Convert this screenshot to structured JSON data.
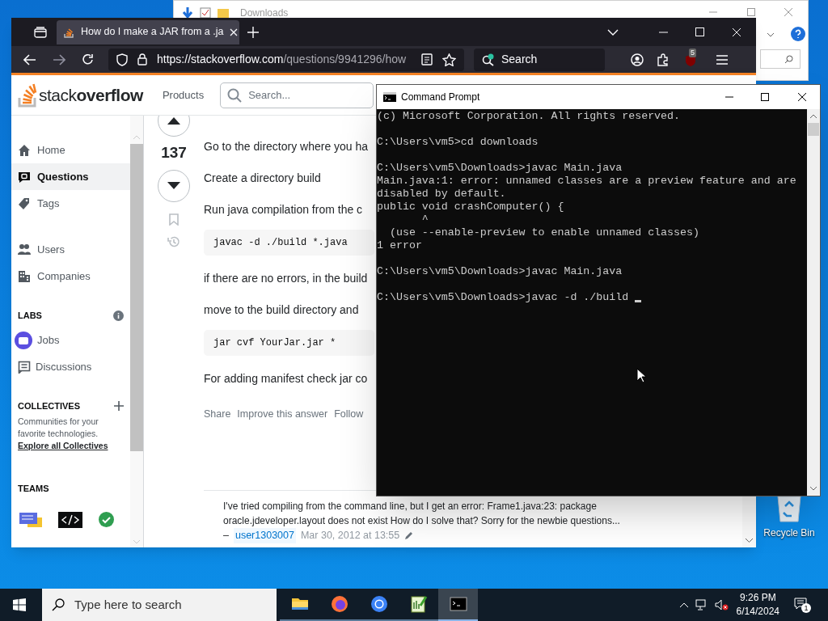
{
  "explorer": {
    "title": "Downloads"
  },
  "browser": {
    "tab_title": "How do I make a JAR from a .ja",
    "url_host": "https://stackoverflow.com",
    "url_path": "/questions/9941296/how",
    "search_placeholder": "Search",
    "extension_badge": "5"
  },
  "site": {
    "logo_light": "stack",
    "logo_bold": "overflow",
    "products": "Products",
    "search_placeholder": "Search...",
    "nav": [
      {
        "label": "Home",
        "selected": false
      },
      {
        "label": "Questions",
        "selected": true
      },
      {
        "label": "Tags",
        "selected": false
      },
      {
        "label": "Users",
        "selected": false
      },
      {
        "label": "Companies",
        "selected": false
      }
    ],
    "labs_heading": "LABS",
    "labs": [
      {
        "label": "Jobs"
      },
      {
        "label": "Discussions"
      }
    ],
    "collectives_heading": "COLLECTIVES",
    "collectives_text": "Communities for your favorite technologies.",
    "collectives_link": "Explore all Collectives",
    "teams_heading": "TEAMS"
  },
  "answer": {
    "score": "137",
    "paragraphs": [
      {
        "kind": "text",
        "text": "Go to the directory where you ha"
      },
      {
        "kind": "text",
        "text": "Create a directory build"
      },
      {
        "kind": "text",
        "text": "Run java compilation from the c"
      },
      {
        "kind": "code",
        "text": "javac -d ./build *.java"
      },
      {
        "kind": "text",
        "text": "if there are no errors, in the build"
      },
      {
        "kind": "text",
        "text": "move to the build directory and"
      },
      {
        "kind": "code",
        "text": "jar cvf YourJar.jar *"
      },
      {
        "kind": "text",
        "text": "For adding manifest check jar co"
      }
    ],
    "actions": [
      "Share",
      "Improve this answer",
      "Follow"
    ]
  },
  "comment": {
    "text": "I've tried compiling from the command line, but I get an error: Frame1.java:23: package oracle.jdeveloper.layout does not exist How do I solve that? Sorry for the newbie questions...",
    "dash": "–",
    "user": "user1303007",
    "date": "Mar 30, 2012 at 13:55"
  },
  "cmd": {
    "title": "Command Prompt",
    "blocks": [
      [
        "(c) Microsoft Corporation. All rights reserved."
      ],
      [
        "C:\\Users\\vm5>cd downloads"
      ],
      [
        "C:\\Users\\vm5\\Downloads>javac Main.java",
        "Main.java:1: error: unnamed classes are a preview feature and are",
        "disabled by default.",
        "public void crashComputer() {",
        "       ^",
        "  (use --enable-preview to enable unnamed classes)",
        "1 error"
      ],
      [
        "C:\\Users\\vm5\\Downloads>javac Main.java"
      ],
      [
        "C:\\Users\\vm5\\Downloads>javac -d ./build "
      ]
    ],
    "cursor": true
  },
  "desktop": {
    "recycle_bin": "Recycle Bin"
  },
  "taskbar": {
    "search_placeholder": "Type here to search",
    "apps": [
      {
        "selected": false
      },
      {
        "selected": false
      },
      {
        "selected": false
      },
      {
        "selected": false
      },
      {
        "selected": true
      }
    ],
    "time": "9:26 PM",
    "date": "6/14/2024",
    "notifications": "1"
  }
}
